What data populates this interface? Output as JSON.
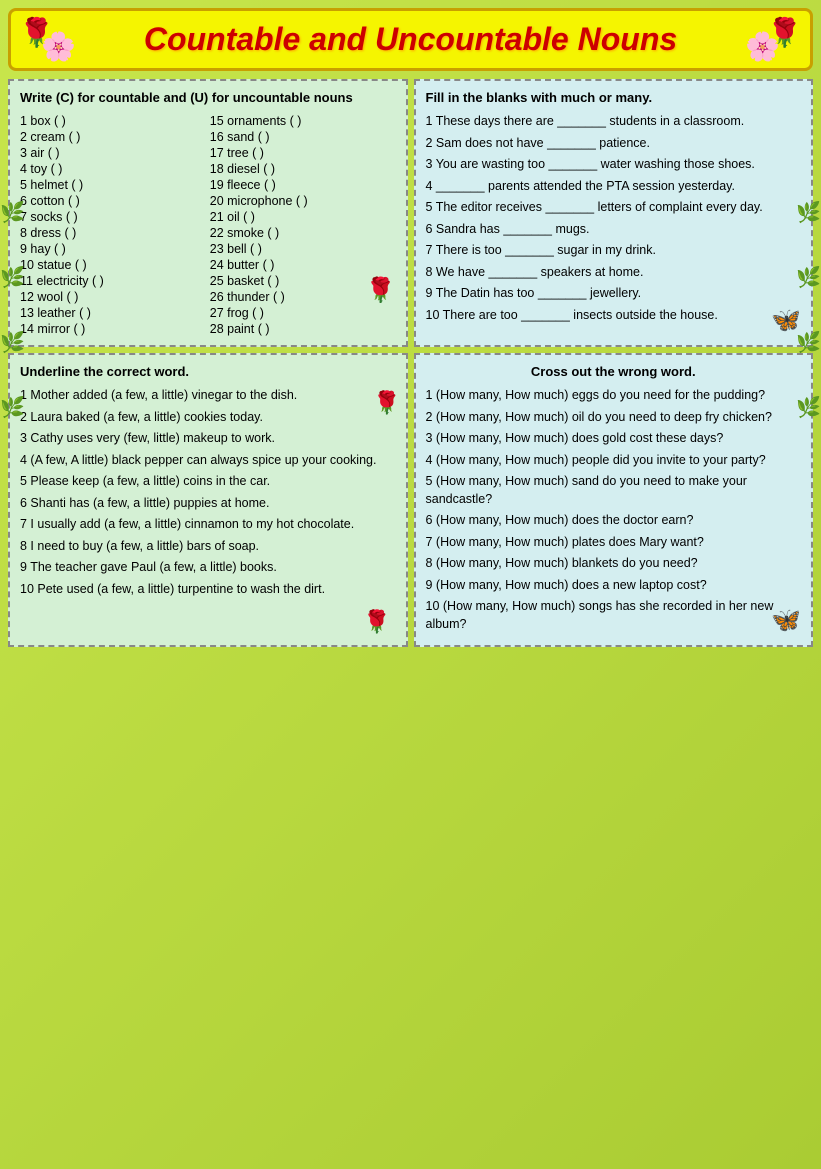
{
  "header": {
    "title": "Countable and Uncountable Nouns"
  },
  "section1": {
    "instruction": "Write (C) for countable and (U) for uncountable nouns",
    "items_left": [
      "1 box  (  )",
      "2 cream  (  )",
      "3 air  (  )",
      "4 toy  (  )",
      "5 helmet  (  )",
      "6 cotton  (  )",
      "7 socks  (  )",
      "8 dress  (  )",
      "9 hay  (  )",
      "10 statue  (  )",
      "11 electricity  (  )",
      "12 wool  (  )",
      "13 leather  (  )",
      "14 mirror  (  )"
    ],
    "items_right": [
      "15 ornaments  (  )",
      "16 sand  (  )",
      "17 tree  (  )",
      "18 diesel  (  )",
      "19 fleece  (  )",
      "20 microphone  (  )",
      "21 oil  (  )",
      "22 smoke  (  )",
      "23 bell  (  )",
      "24 butter  (  )",
      "25 basket  (  )",
      "26 thunder  (  )",
      "27 frog  (  )",
      "28 paint  (  )"
    ]
  },
  "section2": {
    "instruction": "Fill in the blanks with much or many.",
    "items": [
      "1 These days there are _______ students in a classroom.",
      "2 Sam does not have _______ patience.",
      "3 You are wasting too _______ water washing those shoes.",
      "4 _______ parents attended the PTA session yesterday.",
      "5 The editor receives _______ letters of complaint every day.",
      "6 Sandra has _______ mugs.",
      "7 There is too _______ sugar in my drink.",
      "8 We have _______ speakers at home.",
      "9 The Datin has too _______ jewellery.",
      "10 There are too _______ insects outside the house."
    ]
  },
  "section3": {
    "instruction": "Underline the correct word.",
    "items": [
      "1 Mother added (a few, a little) vinegar to the dish.",
      "2 Laura baked (a few, a little) cookies today.",
      "3 Cathy uses very (few, little) makeup to work.",
      "4 (A few, A little) black pepper can always spice up your cooking.",
      "5 Please keep (a few, a little) coins in the car.",
      "6 Shanti has (a few, a little) puppies at home.",
      "7 I usually add (a few, a little) cinnamon to my hot chocolate.",
      "8 I need to buy (a few, a little) bars of soap.",
      "9 The teacher gave Paul (a few, a little) books.",
      "10 Pete used (a few, a little) turpentine to wash the dirt."
    ]
  },
  "section4": {
    "instruction": "Cross out the wrong word.",
    "items": [
      "1 (How many, How much) eggs do you need for the pudding?",
      "2 (How many, How much) oil do you need to deep fry chicken?",
      "3 (How many, How much) does gold cost these days?",
      "4 (How many, How much) people did you invite to your party?",
      "5 (How many, How much) sand do you need to make your sandcastle?",
      "6 (How many, How much) does the doctor earn?",
      "7 (How many, How much) plates does Mary want?",
      "8 (How many, How much) blankets do you need?",
      "9 (How many, How much) does a new laptop cost?",
      "10 (How many, How much) songs has she recorded in her new album?"
    ]
  }
}
